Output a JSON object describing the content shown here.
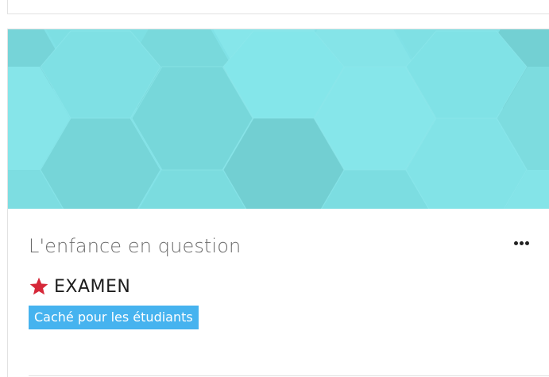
{
  "course": {
    "name": "L'enfance en question",
    "category_label": "EXAMEN",
    "visibility_badge": "Caché pour les étudiants",
    "menu_icon": "more-horizontal-icon",
    "category_icon": "star-icon"
  },
  "colors": {
    "pattern_base": "#80e1e6",
    "star": "#d62839",
    "badge_bg": "#46b3ef",
    "badge_text": "#ffffff"
  }
}
